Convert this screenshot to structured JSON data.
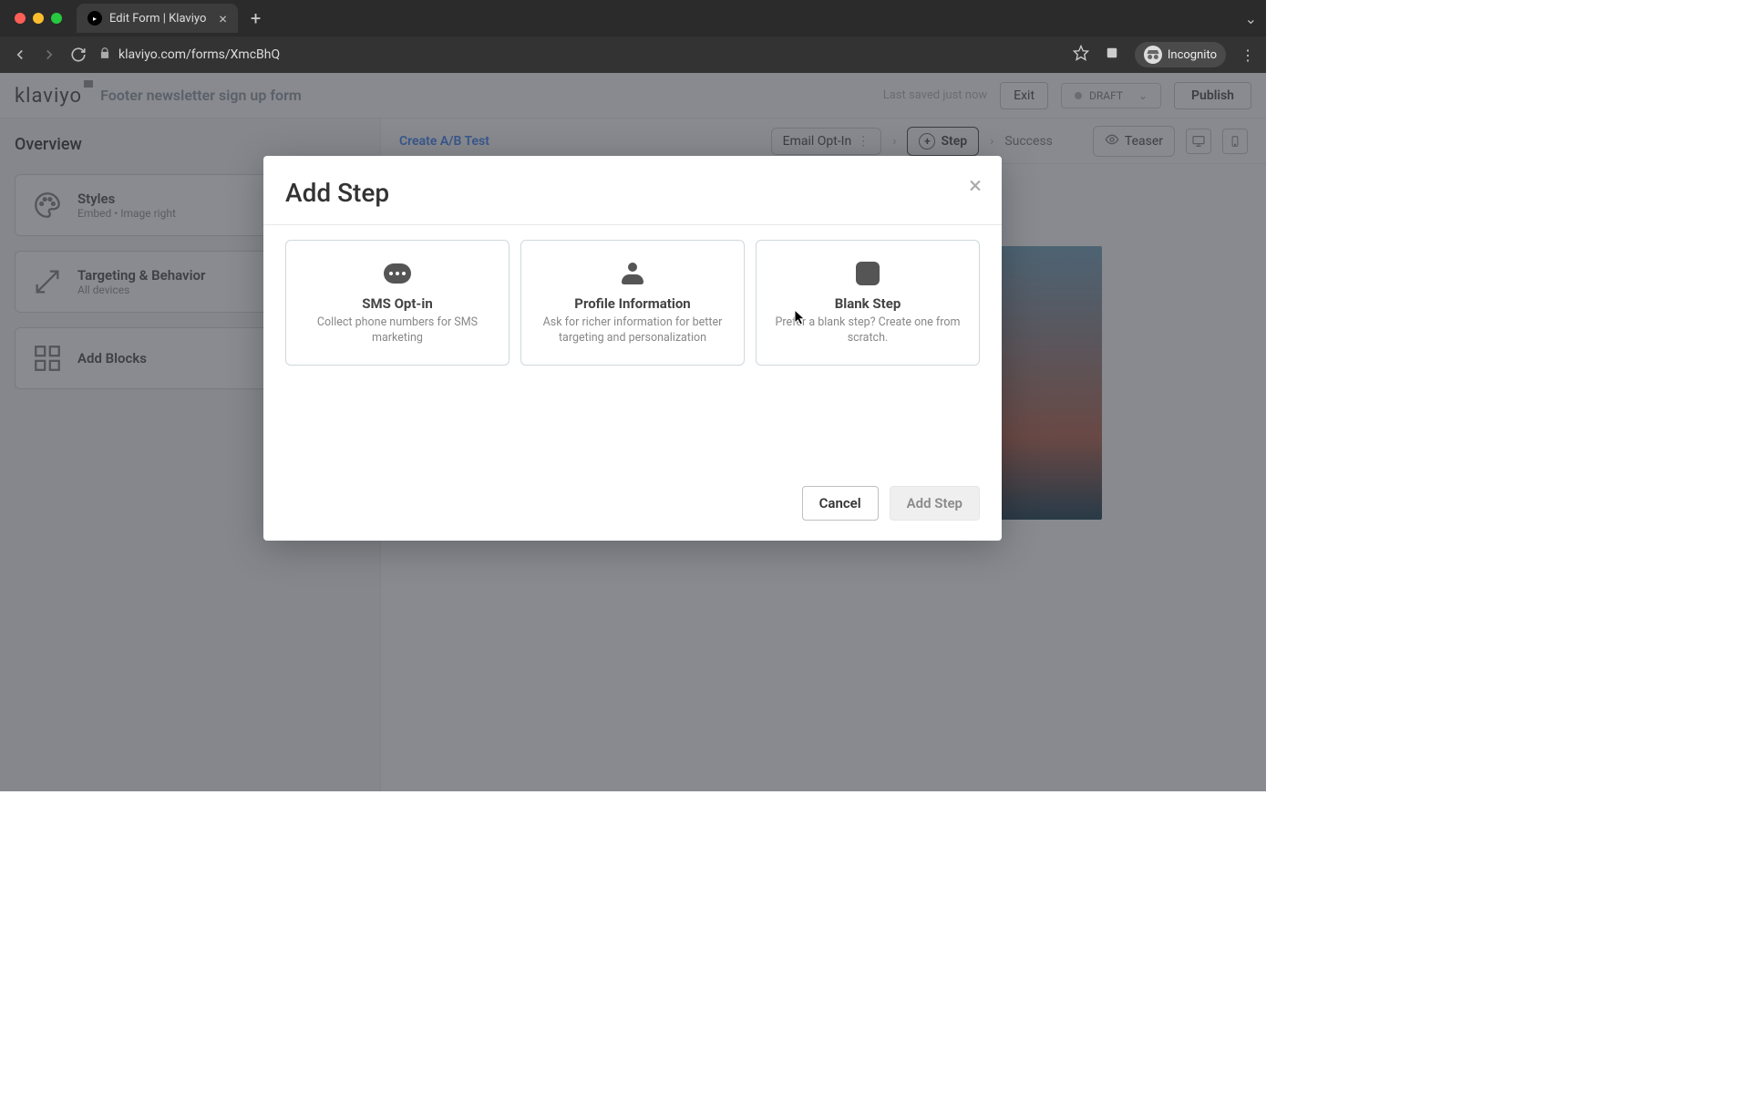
{
  "browser": {
    "tab_title": "Edit Form | Klaviyo",
    "url": "klaviyo.com/forms/XmcBhQ",
    "incognito_label": "Incognito"
  },
  "header": {
    "logo_text": "klaviyo",
    "form_title": "Footer newsletter sign up form",
    "save_status": "Last saved just now",
    "exit_label": "Exit",
    "status_badge": "DRAFT",
    "publish_label": "Publish"
  },
  "sidebar": {
    "title": "Overview",
    "cards": {
      "styles": {
        "title": "Styles",
        "subtitle": "Embed • Image right"
      },
      "targeting": {
        "title": "Targeting & Behavior",
        "subtitle": "All devices"
      },
      "blocks": {
        "title": "Add Blocks"
      }
    }
  },
  "topbar": {
    "abtest": "Create A/B Test",
    "steps": {
      "email": "Email Opt-In",
      "add": "Step",
      "success": "Success",
      "teaser": "Teaser"
    }
  },
  "modal": {
    "title": "Add Step",
    "cards": {
      "sms": {
        "title": "SMS Opt-in",
        "desc": "Collect phone numbers for SMS marketing"
      },
      "profile": {
        "title": "Profile Information",
        "desc": "Ask for richer information for better targeting and personalization"
      },
      "blank": {
        "title": "Blank Step",
        "desc": "Prefer a blank step? Create one from scratch."
      }
    },
    "cancel": "Cancel",
    "add": "Add Step"
  }
}
